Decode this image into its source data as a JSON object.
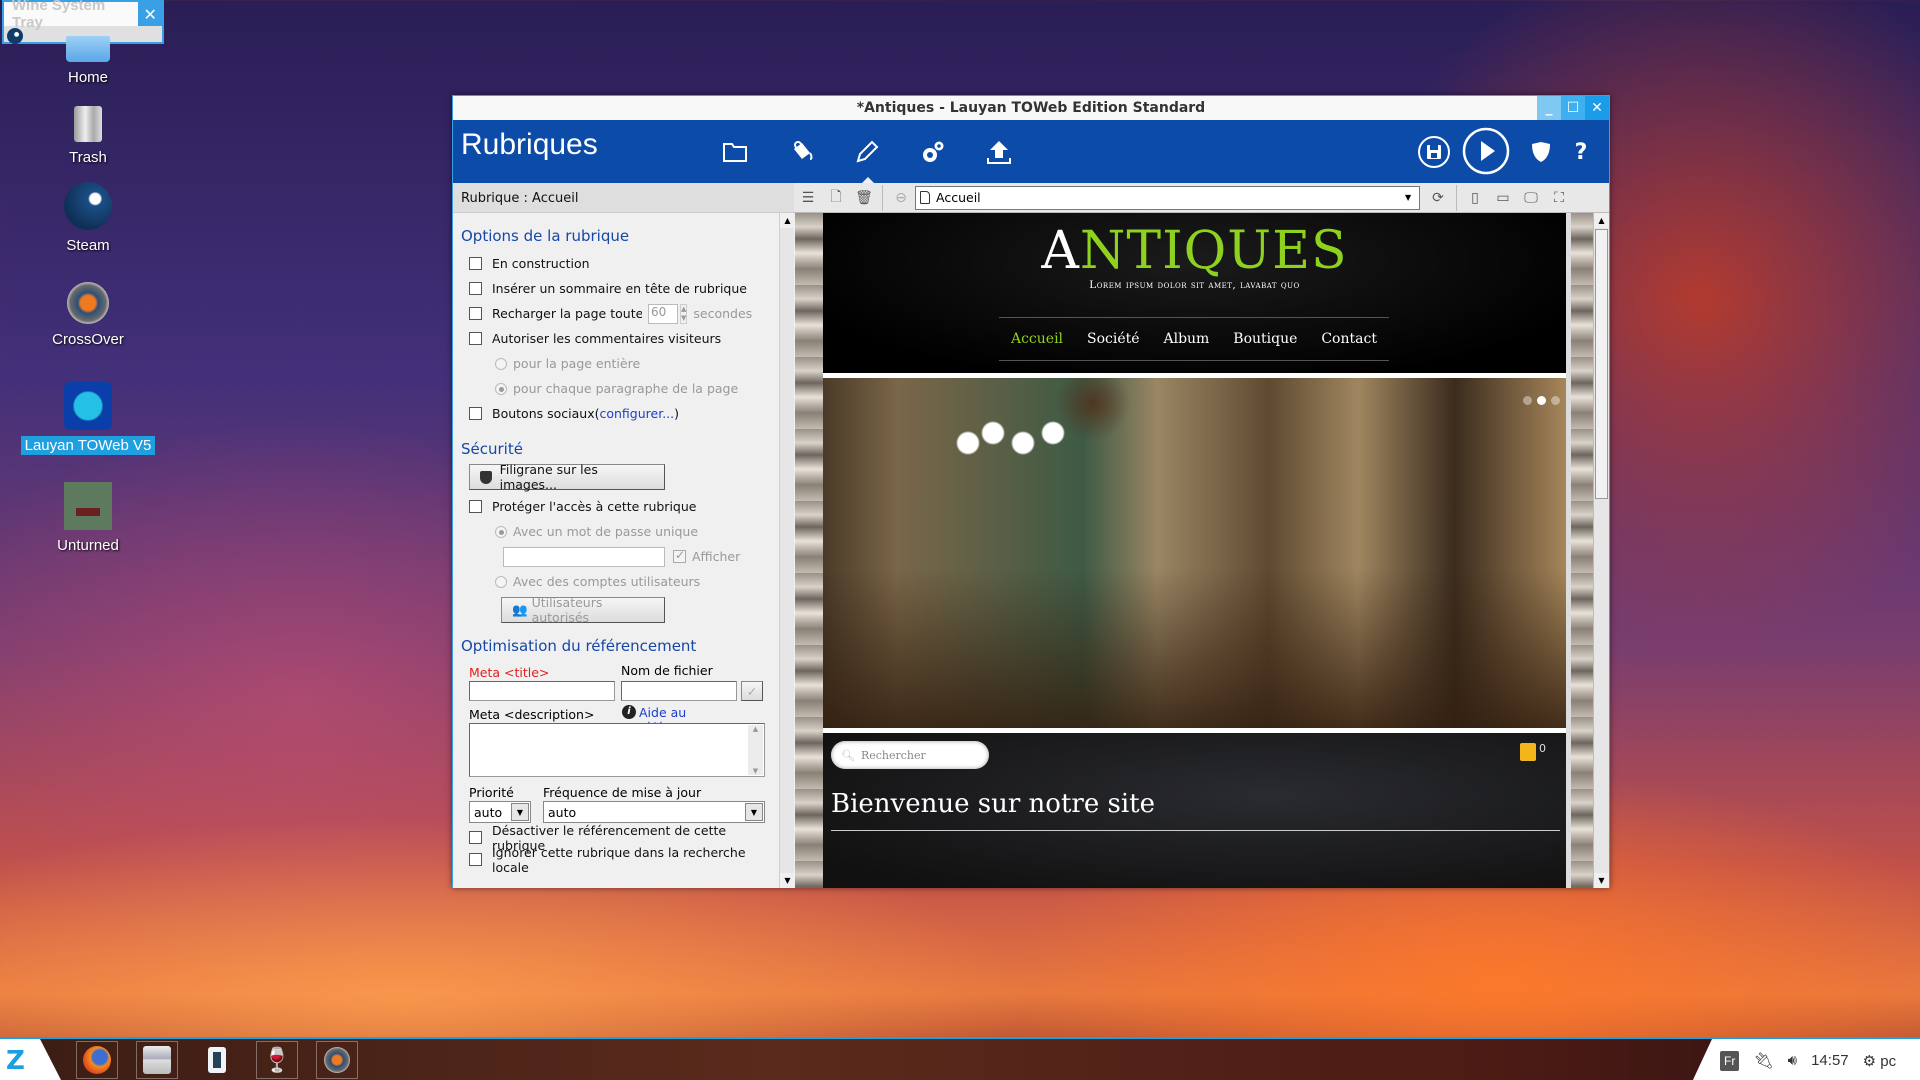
{
  "wine_tray": {
    "title": "Wine System Tray",
    "close_label": "✕"
  },
  "desktop": {
    "icons": [
      {
        "label": "Home"
      },
      {
        "label": "Trash"
      },
      {
        "label": "Steam"
      },
      {
        "label": "CrossOver"
      },
      {
        "label": "Lauyan TOWeb V5",
        "selected": true
      },
      {
        "label": "Unturned"
      }
    ]
  },
  "window": {
    "title": "*Antiques - Lauyan TOWeb Edition Standard",
    "controls": {
      "minimize": "_",
      "maximize": "☐",
      "close": "✕"
    },
    "header": {
      "section_title": "Rubriques",
      "nav_icons": [
        "folder-icon",
        "paint-bucket-icon",
        "pencil-icon",
        "gears-icon",
        "upload-icon"
      ],
      "active_nav": "pencil-icon",
      "right_icons": [
        "save-icon",
        "play-icon",
        "shield-icon",
        "help-icon"
      ]
    },
    "left_panel": {
      "heading": "Rubrique : Accueil",
      "options_section": {
        "title": "Options de la rubrique",
        "en_construction": {
          "label": "En construction",
          "checked": false
        },
        "inserer_sommaire": {
          "label": "Insérer un sommaire en tête de rubrique",
          "checked": false
        },
        "recharger": {
          "label": "Recharger la page toute l",
          "checked": false,
          "value": "60",
          "unit": "secondes"
        },
        "autoriser_commentaires": {
          "label": "Autoriser les commentaires visiteurs",
          "checked": false
        },
        "radio_page_entiere": {
          "label": "pour la page entière",
          "selected": false
        },
        "radio_paragraphe": {
          "label": "pour chaque paragraphe de la page",
          "selected": true
        },
        "boutons_sociaux": {
          "label": "Boutons sociaux(",
          "link": "configurer...",
          "suffix": ")",
          "checked": false
        }
      },
      "security_section": {
        "title": "Sécurité",
        "watermark_button": "Filigrane sur les images...",
        "proteger": {
          "label": "Protéger l'accès à cette rubrique",
          "checked": false
        },
        "radio_mot_de_passe": {
          "label": "Avec un mot de passe unique",
          "selected": true
        },
        "password_value": "",
        "afficher": {
          "label": "Afficher",
          "checked": true
        },
        "radio_comptes": {
          "label": "Avec des comptes utilisateurs",
          "selected": false
        },
        "users_button": "Utilisateurs autorisés"
      },
      "seo_section": {
        "title": "Optimisation du référencement",
        "meta_title_label": "Meta <title>",
        "meta_title_value": "",
        "filename_label": "Nom de fichier",
        "filename_value": "",
        "meta_description_label": "Meta <description>",
        "meta_description_value": "",
        "help_link": "Aide au référencement",
        "priority_label": "Priorité",
        "priority_value": "auto",
        "frequency_label": "Fréquence de mise à jour",
        "frequency_value": "auto",
        "desactiver": {
          "label": "Désactiver le référencement de cette rubrique",
          "checked": false
        },
        "ignorer": {
          "label": "Ignorer cette rubrique dans la recherche locale",
          "checked": false
        }
      }
    },
    "preview_toolbar": {
      "page_select_value": "Accueil",
      "icons": [
        "list-icon",
        "new-page-icon",
        "trash-icon",
        "back-icon",
        "refresh-icon",
        "phone-icon",
        "tablet-icon",
        "desktop-icon",
        "fullscreen-icon"
      ]
    },
    "site_preview": {
      "logo_first": "A",
      "logo_rest": "NTIQUES",
      "tagline": "Lorem ipsum dolor sit amet, lavabat quo",
      "nav": [
        "Accueil",
        "Société",
        "Album",
        "Boutique",
        "Contact"
      ],
      "active_nav": "Accueil",
      "slideshow": {
        "slides": 3,
        "active": 2
      },
      "search_placeholder": "Rechercher",
      "cart_count": "0",
      "welcome_heading": "Bienvenue sur notre site",
      "accent_color": "#8ed21f"
    }
  },
  "taskbar": {
    "apps": [
      "firefox",
      "file-manager",
      "media-player",
      "wine",
      "crossover"
    ],
    "tray": {
      "keyboard_layout": "Fr",
      "time": "14:57",
      "user": "pc"
    }
  }
}
